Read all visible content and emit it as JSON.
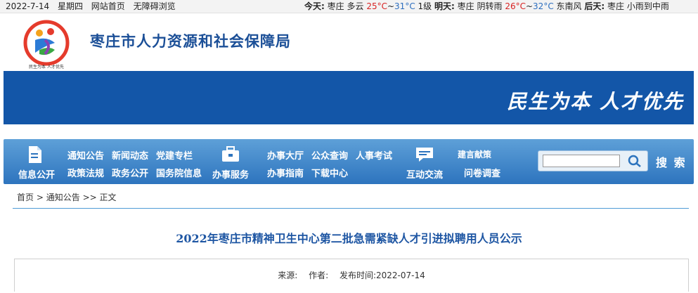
{
  "topbar": {
    "date": "2022-7-14",
    "weekday": "星期四",
    "home_link": "网站首页",
    "accessible_link": "无障碍浏览",
    "today_label": "今天:",
    "today_city": "枣庄",
    "today_weather": "多云",
    "today_low": "25°C",
    "today_tilde": "~",
    "today_high": "31°C",
    "today_wind": "1级",
    "tomorrow_label": "明天:",
    "tomorrow_city": "枣庄",
    "tomorrow_weather": "阴转雨",
    "tomorrow_low": "26°C",
    "tomorrow_tilde": "~",
    "tomorrow_high": "32°C",
    "tomorrow_wind": "东南风",
    "dayafter_label": "后天:",
    "dayafter_city": "枣庄",
    "dayafter_weather": "小雨到中雨"
  },
  "header": {
    "site_title": "枣庄市人力资源和社会保障局",
    "logo_caption": "民生为本 人才优先",
    "banner_slogan": "民生为本 人才优先"
  },
  "nav": {
    "info_public": "信息公开",
    "info_links_row1": [
      "通知公告",
      "新闻动态",
      "党建专栏"
    ],
    "info_links_row2": [
      "政策法规",
      "政务公开",
      "国务院信息"
    ],
    "service": "办事服务",
    "service_links_row1": [
      "办事大厅",
      "公众查询",
      "人事考试"
    ],
    "service_links_row2": [
      "办事指南",
      "下载中心"
    ],
    "interact": "互动交流",
    "interact_links_row1": [
      "建言献策"
    ],
    "interact_links_row2": [
      "问卷调查"
    ],
    "search_value": "",
    "search_button": "搜 索"
  },
  "breadcrumb": {
    "home": "首页",
    "sep1": ">",
    "section": "通知公告",
    "sep2": ">>",
    "current": "正文"
  },
  "article": {
    "title": "2022年枣庄市精神卫生中心第二批急需紧缺人才引进拟聘用人员公示",
    "source_label": "来源:",
    "author_label": "作者:",
    "date_label": "发布时间:",
    "date": "2022-07-14"
  },
  "colors": {
    "brand_blue": "#1356a8",
    "title_blue": "#1e56a3",
    "temp_red": "#d82323",
    "temp_blue": "#2e6fbf"
  }
}
